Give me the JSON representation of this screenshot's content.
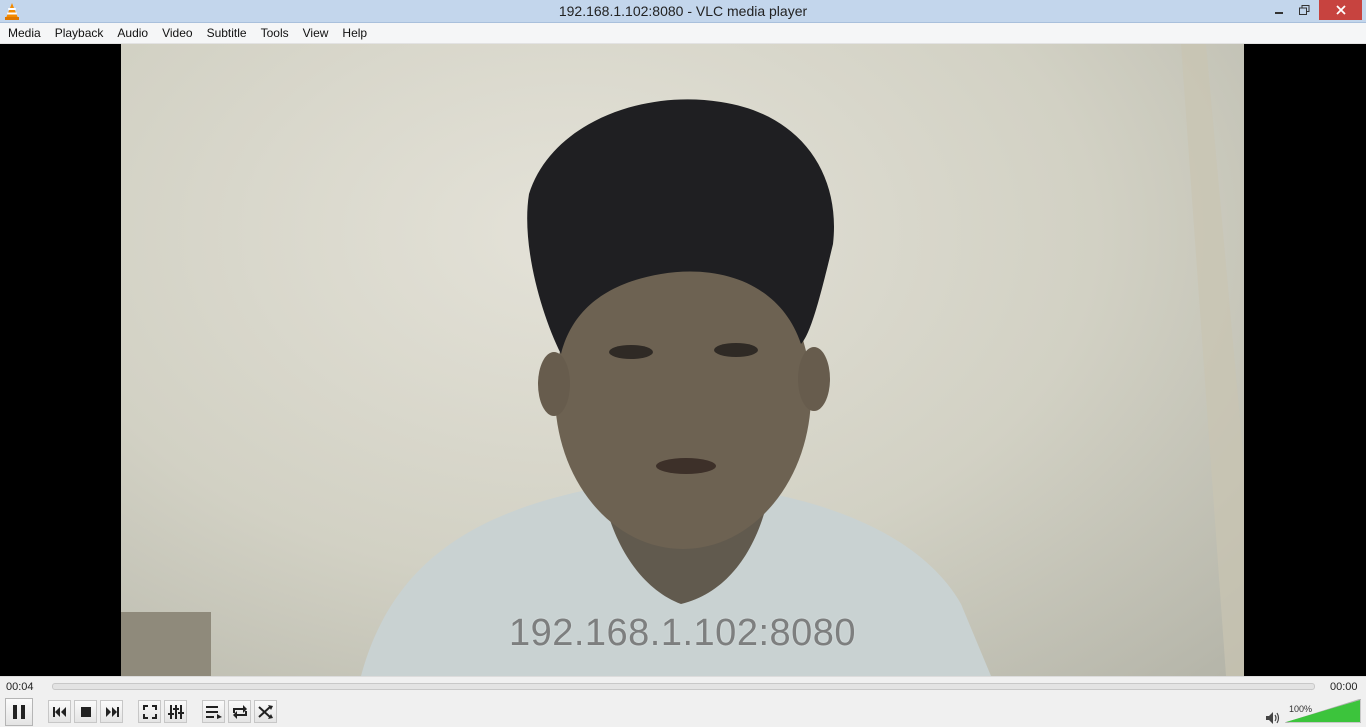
{
  "window": {
    "title": "192.168.1.102:8080 - VLC media player",
    "app_icon": "vlc-cone-icon",
    "buttons": {
      "minimize": "minimize-icon",
      "restore": "restore-icon",
      "close": "close-icon"
    }
  },
  "menu": {
    "items": [
      {
        "label": "Media"
      },
      {
        "label": "Playback"
      },
      {
        "label": "Audio"
      },
      {
        "label": "Video"
      },
      {
        "label": "Subtitle"
      },
      {
        "label": "Tools"
      },
      {
        "label": "View"
      },
      {
        "label": "Help"
      }
    ]
  },
  "video": {
    "overlay_text": "192.168.1.102:8080"
  },
  "controls": {
    "elapsed": "00:04",
    "total": "00:00",
    "seek_position": 0,
    "volume_label": "100%",
    "volume_level": 1.0,
    "buttons": [
      {
        "name": "pause-button",
        "icon": "pause-icon"
      },
      {
        "name": "previous-button",
        "icon": "previous-icon"
      },
      {
        "name": "stop-button",
        "icon": "stop-icon"
      },
      {
        "name": "next-button",
        "icon": "next-icon"
      },
      {
        "name": "fullscreen-button",
        "icon": "fullscreen-icon"
      },
      {
        "name": "extended-settings-button",
        "icon": "equalizer-icon"
      },
      {
        "name": "playlist-button",
        "icon": "playlist-icon"
      },
      {
        "name": "loop-button",
        "icon": "loop-icon"
      },
      {
        "name": "random-button",
        "icon": "shuffle-icon"
      }
    ]
  },
  "colors": {
    "titlebar": "#c3d6ec",
    "close_button": "#c7433f",
    "volume_fill": "#3cc43c",
    "vlc_orange": "#f48b00"
  }
}
